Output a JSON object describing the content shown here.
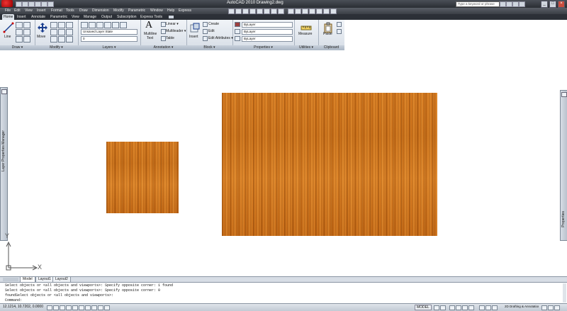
{
  "app": {
    "title": "AutoCAD 2010    Drawing2.dwg",
    "search_placeholder": "Type a keyword or phrase",
    "window_controls": [
      "_",
      "□",
      "×"
    ]
  },
  "menu": {
    "items": [
      "File",
      "Edit",
      "View",
      "Insert",
      "Format",
      "Tools",
      "Draw",
      "Dimension",
      "Modify",
      "Parametric",
      "Window",
      "Help",
      "Express"
    ]
  },
  "ribbon_tabs": [
    {
      "label": "Home",
      "active": true
    },
    {
      "label": "Insert",
      "active": false
    },
    {
      "label": "Annotate",
      "active": false
    },
    {
      "label": "Parametric",
      "active": false
    },
    {
      "label": "View",
      "active": false
    },
    {
      "label": "Manage",
      "active": false
    },
    {
      "label": "Output",
      "active": false
    },
    {
      "label": "Subscription",
      "active": false
    },
    {
      "label": "Express Tools",
      "active": false
    }
  ],
  "ribbon": {
    "draw": {
      "title": "Draw ▾",
      "line_label": "Line"
    },
    "modify": {
      "title": "Modify ▾",
      "move_label": "Move"
    },
    "layers": {
      "title": "Layers ▾",
      "layer_state": "Unsaved Layer State",
      "current_layer": "0"
    },
    "annotation": {
      "title": "Annotation ▾",
      "mtext_label": "Multiline",
      "mtext_label2": "Text",
      "linear": "Linear ▾",
      "multileader": "Multileader ▾",
      "table": "Table"
    },
    "block": {
      "title": "Block ▾",
      "insert": "Insert",
      "create": "Create",
      "edit": "Edit",
      "edit_attributes": "Edit Attributes ▾"
    },
    "properties": {
      "title": "Properties ▾",
      "color": "ByLayer",
      "linetype": "ByLayer",
      "lineweight": "ByLayer"
    },
    "utilities": {
      "title": "Utilities ▾",
      "measure": "Measure"
    },
    "clipboard": {
      "title": "Clipboard",
      "paste": "Paste"
    }
  },
  "palettes": {
    "left": "Layer Properties Manager",
    "right": "Properties"
  },
  "ucs": {
    "x_label": "X",
    "y_label": "Y"
  },
  "layout_tabs": [
    {
      "label": "Model",
      "active": true
    },
    {
      "label": "Layout1",
      "active": false
    },
    {
      "label": "Layout2",
      "active": false
    }
  ],
  "command_history": [
    "Select objects or <all objects and viewports>: Specify opposite corner: 1 found",
    "Select objects or <all objects and viewports>: Specify opposite corner: 0",
    "foundSelect objects or <all objects and viewports>:"
  ],
  "command_prompt": "Command:",
  "status": {
    "coordinates": "12.1214, 10.7202, 0.0000",
    "model_label": "MODEL",
    "workspace": "2D Drafting & Annotation ▾"
  }
}
